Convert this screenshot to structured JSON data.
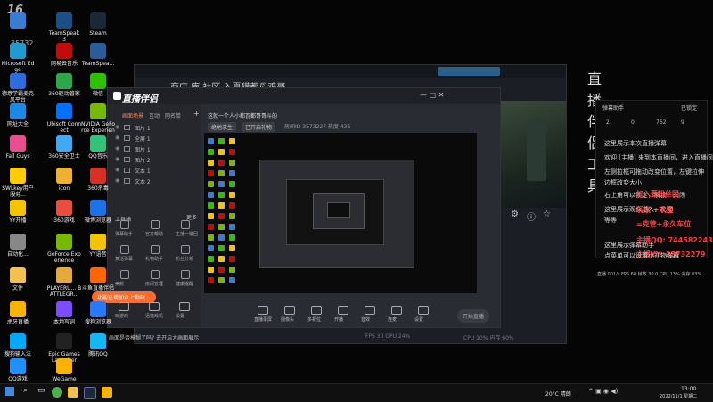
{
  "watermark": {
    "brand": "16",
    "sub": "35732"
  },
  "desktop_icons": [
    {
      "label": "",
      "color": "#3a7bd5"
    },
    {
      "label": "TeamSpeak 3",
      "color": "#1b4f8a"
    },
    {
      "label": "Steam",
      "color": "#1b2838"
    },
    {
      "label": "Microsoft Edge",
      "color": "#1f9bd1"
    },
    {
      "label": "网易云音乐",
      "color": "#c20c0c"
    },
    {
      "label": "TeamSpea...",
      "color": "#2b5d9a"
    },
    {
      "label": "德意学霸麦克风平台",
      "color": "#2d6cdf"
    },
    {
      "label": "360驱动管家",
      "color": "#2aa84a"
    },
    {
      "label": "微信",
      "color": "#2dc100"
    },
    {
      "label": "网址大全",
      "color": "#1e88e5"
    },
    {
      "label": "Ubisoft Connect",
      "color": "#0070ff"
    },
    {
      "label": "NVIDIA GeForce Experience",
      "color": "#76b900"
    },
    {
      "label": "Fall Guys",
      "color": "#e94f8f"
    },
    {
      "label": "360安全卫士",
      "color": "#3fa9f5"
    },
    {
      "label": "QQ音乐",
      "color": "#31c27c"
    },
    {
      "label": "SWLkey用户服务...",
      "color": "#ffcc00"
    },
    {
      "label": "icon",
      "color": "#f0b030"
    },
    {
      "label": "360杀毒",
      "color": "#d93025"
    },
    {
      "label": "YY开播",
      "color": "#f5c400"
    },
    {
      "label": "360游戏",
      "color": "#e84d3d"
    },
    {
      "label": "微博浏览器",
      "color": "#1a73e8"
    },
    {
      "label": "自动化...",
      "color": "#888888"
    },
    {
      "label": "GeForce Experience",
      "color": "#76b900"
    },
    {
      "label": "YY语音",
      "color": "#f5c400"
    },
    {
      "label": "文件",
      "color": "#f2c14e"
    },
    {
      "label": "PLAYERU... BATTLEGR...",
      "color": "#e6a93b"
    },
    {
      "label": "斗鱼直播伴侣",
      "color": "#ff6600"
    },
    {
      "label": "虎牙直播",
      "color": "#f8b400"
    },
    {
      "label": "本地写词",
      "color": "#7c4dff"
    },
    {
      "label": "搜狗浏览器",
      "color": "#2979ff"
    },
    {
      "label": "搜狗输入法",
      "color": "#00aaff"
    },
    {
      "label": "Epic Games Launcher",
      "color": "#222222"
    },
    {
      "label": "腾讯QQ",
      "color": "#12b7f5"
    },
    {
      "label": "QQ游戏",
      "color": "#1e90ff"
    },
    {
      "label": "WeGame",
      "color": "#ffb300"
    }
  ],
  "back_window": {
    "title": "商店   库   社区   入夏猎都母鸡哥",
    "corner_label": "直播伴侣工具"
  },
  "streamer_app": {
    "logo": "直播伴侣",
    "left_tabs": [
      "画面场景",
      "互动",
      "网名单"
    ],
    "scenes": [
      "图片 1",
      "全屏 1",
      "图片 1",
      "图片 2",
      "文本 1",
      "文本 2"
    ],
    "tools_header": "工具箱",
    "tools_more": "更多",
    "tools_row1": [
      "弹幕助手",
      "官方帮助",
      "主播一键回"
    ],
    "tools_row2": [
      "复活弹幕",
      "礼物助手",
      "粉丝分析"
    ],
    "tools_row3": [
      "美颜",
      "房间管理",
      "健康提醒"
    ],
    "bottom_left": [
      "玩游戏",
      "迅猎戏机",
      "设置"
    ],
    "notice": "功能已增加以上勤政...",
    "stream_title": "这就一个人小都瓦都哥哥斗的",
    "tags": [
      "绝地求生",
      "已开启礼物"
    ],
    "room_info": "房间ID   3573227   热度 436",
    "toolbar": [
      "直播录屏",
      "摄像头",
      "多机位",
      "开播",
      "音效",
      "连麦",
      "设置"
    ],
    "start_button": "开始直播",
    "footer": "画面是否模糊了吗? 去开启大画面展示",
    "footer_right": "CPU 10% 内存 60%",
    "fps": "FPS 30 GPU 24%"
  },
  "chat": {
    "header": "弹幕助手",
    "pin": "已锁定",
    "counts": [
      "2",
      "0",
      "762",
      "9"
    ],
    "lines": [
      "这里展示本次直播弹幕",
      "欢迎 [主播] 来到本直播间，进入直播间",
      "左侧拉框可拖动改变位置，左键拉伸",
      "边框改变大小",
      "右上角可以锁定，解锁，关闭",
      "这里展示观众进入，礼物",
      "等等"
    ],
    "gifts": [
      "加入要粉丝团",
      "玩家 +欢迎",
      "=克管+永久车位",
      "主播QQ: 744582243",
      "主播YY: 35732279"
    ],
    "extra": [
      "这里展示弹幕助手",
      "点菜单可以设置小礼物弹幕"
    ],
    "stats": "直播 001/s FPS 60 帧数 30.0   CPU 13% 内存 83%"
  },
  "taskbar": {
    "weather": "20°C 晴朗",
    "time": "13:00",
    "date": "2022/11/1 星期二"
  }
}
